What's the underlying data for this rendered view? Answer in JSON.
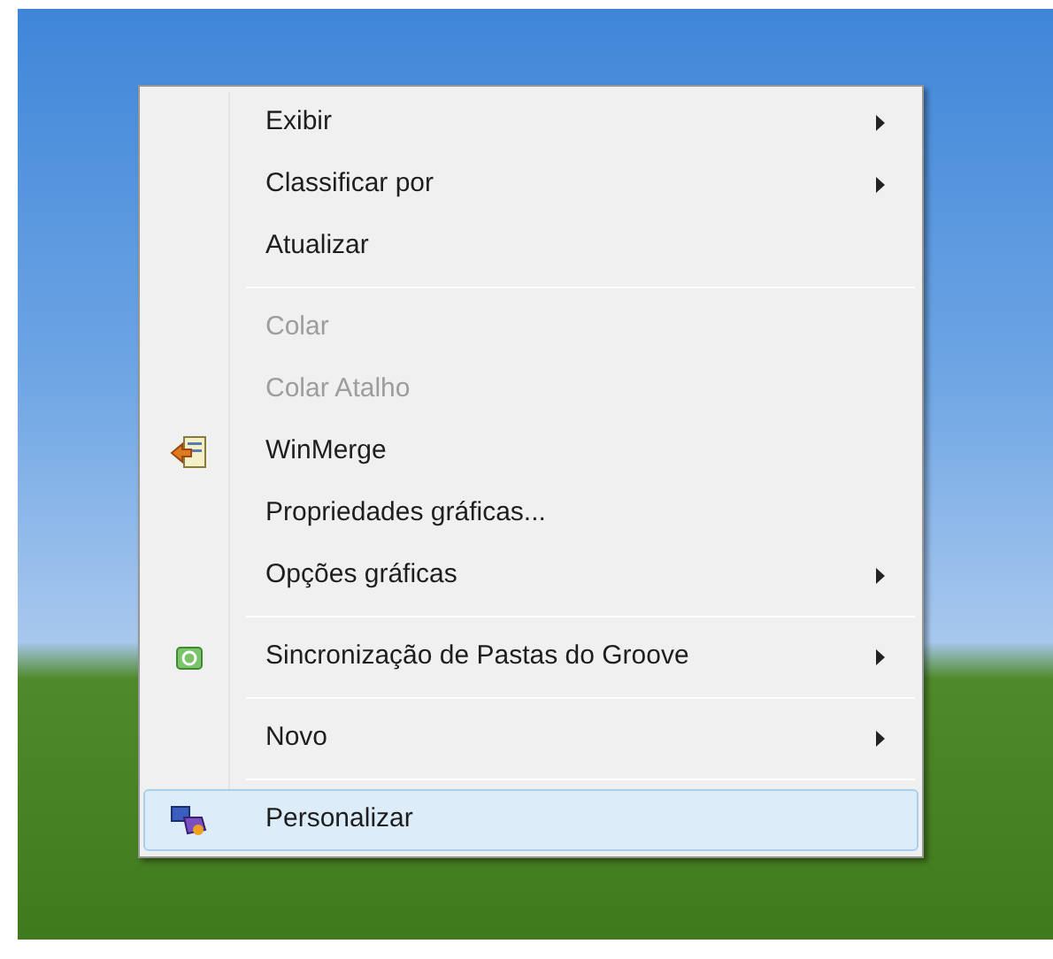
{
  "menu": {
    "items": [
      {
        "kind": "item",
        "label": "Exibir",
        "disabled": false,
        "submenu": true,
        "selected": false
      },
      {
        "kind": "item",
        "label": "Classificar por",
        "disabled": false,
        "submenu": true,
        "selected": false
      },
      {
        "kind": "item",
        "label": "Atualizar",
        "disabled": false,
        "submenu": false,
        "selected": false
      },
      {
        "kind": "separator"
      },
      {
        "kind": "item",
        "label": "Colar",
        "disabled": true,
        "submenu": false,
        "selected": false
      },
      {
        "kind": "item",
        "label": "Colar Atalho",
        "disabled": true,
        "submenu": false,
        "selected": false
      },
      {
        "kind": "item",
        "label": "WinMerge",
        "disabled": false,
        "submenu": false,
        "selected": false
      },
      {
        "kind": "item",
        "label": "Propriedades gráficas...",
        "disabled": false,
        "submenu": false,
        "selected": false
      },
      {
        "kind": "item",
        "label": "Opções gráficas",
        "disabled": false,
        "submenu": true,
        "selected": false
      },
      {
        "kind": "separator"
      },
      {
        "kind": "item",
        "label": "Sincronização de Pastas do Groove",
        "disabled": false,
        "submenu": true,
        "selected": false
      },
      {
        "kind": "separator"
      },
      {
        "kind": "item",
        "label": "Novo",
        "disabled": false,
        "submenu": true,
        "selected": false
      },
      {
        "kind": "separator"
      },
      {
        "kind": "item",
        "label": "Personalizar",
        "disabled": false,
        "submenu": false,
        "selected": true
      }
    ]
  }
}
